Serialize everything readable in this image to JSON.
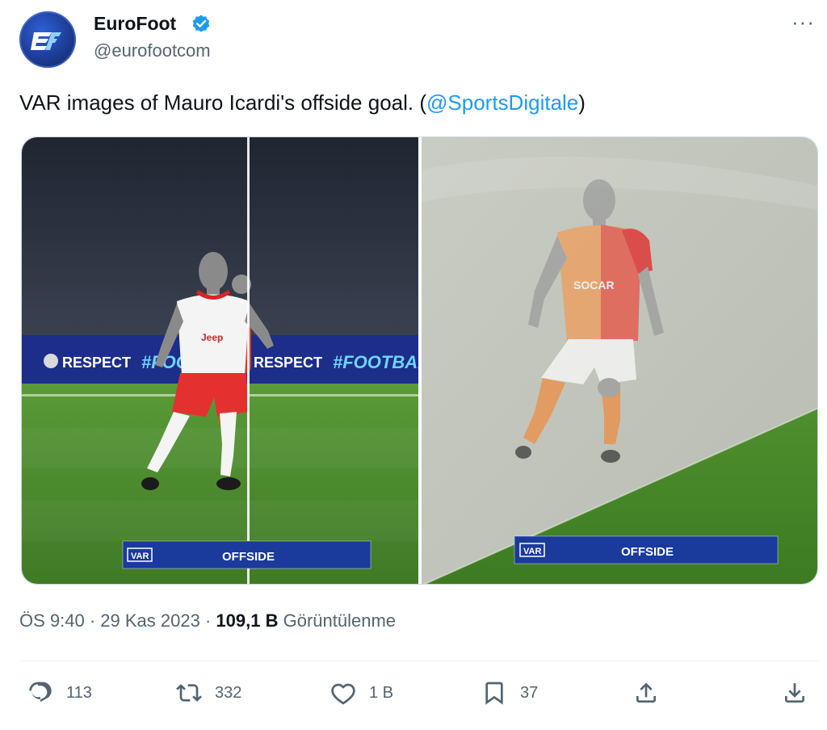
{
  "author": {
    "name": "EuroFoot",
    "handle": "@eurofootcom",
    "verified": true
  },
  "tweet": {
    "text": "VAR images of Mauro Icardi's offside goal. (",
    "mention": "@SportsDigitale",
    "text_end": ")"
  },
  "media": {
    "left": {
      "ad_boards": [
        "RESPECT",
        "#FOOTB",
        "ALL"
      ],
      "banner_tag": "VAR",
      "banner_text": "OFFSIDE",
      "jersey_text": "Jeep"
    },
    "right": {
      "banner_tag": "VAR",
      "banner_text": "OFFSIDE",
      "jersey_text": "SOCAR"
    }
  },
  "meta": {
    "time": "ÖS 9:40",
    "separator": "·",
    "date": "29 Kas 2023",
    "views": "109,1 B",
    "views_label": "Görüntülenme"
  },
  "actions": {
    "replies": "113",
    "retweets": "332",
    "likes": "1 B",
    "bookmarks": "37"
  },
  "colors": {
    "accent": "#1d9bf0",
    "secondary_text": "#536471",
    "primary_text": "#0f1419",
    "var_banner": "#1a3a9c",
    "pitch": "#4a8a2c"
  },
  "icons": [
    "verified-badge-icon",
    "more-icon",
    "reply-icon",
    "retweet-icon",
    "like-icon",
    "bookmark-icon",
    "share-icon",
    "download-icon"
  ]
}
